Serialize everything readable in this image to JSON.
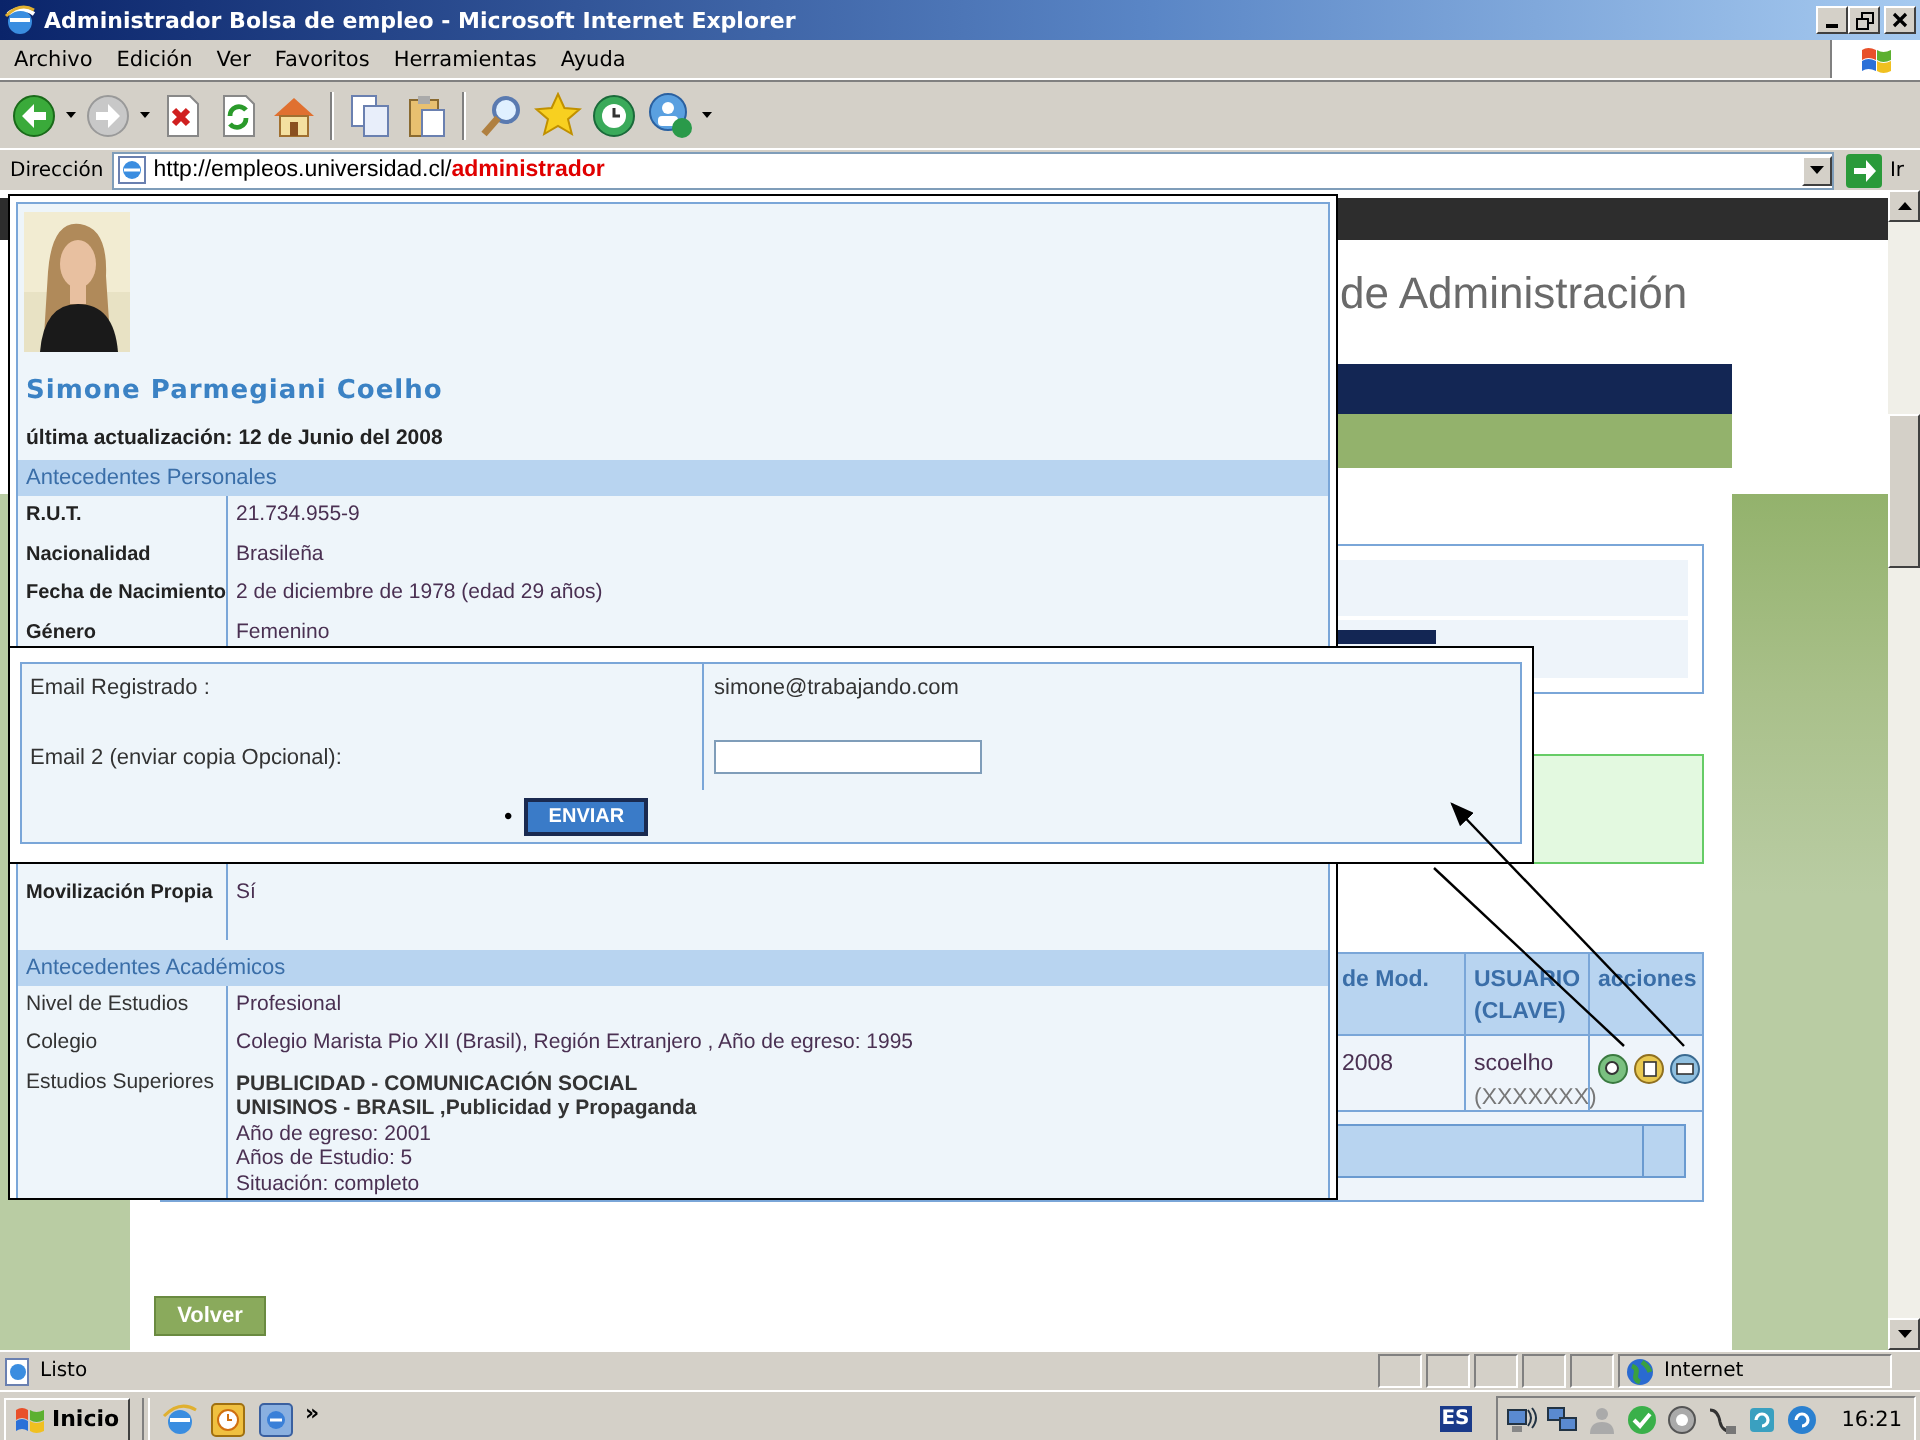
{
  "window": {
    "title": "Administrador Bolsa de empleo - Microsoft Internet Explorer"
  },
  "menu": [
    "Archivo",
    "Edición",
    "Ver",
    "Favoritos",
    "Herramientas",
    "Ayuda"
  ],
  "address_bar": {
    "label": "Dirección",
    "url": "http://empleos.universidad.cl/**administrador**",
    "go_button": "Ir"
  },
  "page": {
    "title": "de Administración",
    "table": {
      "columns": [
        "de Mod.",
        "USUARIO (CLAVE)",
        "acciones"
      ],
      "rows": [
        {
          "date": "2008",
          "user": "scoelho",
          "password": "(XXXXXXX)"
        }
      ]
    },
    "back_button": "Volver"
  },
  "profile": {
    "name": "Simone Parmegiani Coelho",
    "updated": "última actualización: 12 de Junio del 2008",
    "sections": [
      {
        "title": "Antecedentes Personales",
        "kind": "strong",
        "rows": [
          {
            "label": "R.U.T.",
            "value": "21.734.955-9"
          },
          {
            "label": "Nacionalidad",
            "value": "Brasileña"
          },
          {
            "label": "Fecha de Nacimiento",
            "value": "2 de diciembre de 1978 (edad 29 años)"
          },
          {
            "label": "Género",
            "value": "Femenino"
          },
          {
            "label": "Movilización Propia",
            "value": "Sí"
          }
        ]
      },
      {
        "title": "Antecedentes Académicos",
        "kind": "plain",
        "rows": [
          {
            "label": "Nivel de Estudios",
            "value": "Profesional"
          },
          {
            "label": "Colegio",
            "value": "Colegio Marista Pio XII (Brasil), Región Extranjero , Año de egreso: 1995"
          },
          {
            "label": "Estudios Superiores",
            "lines": [
              {
                "text": "PUBLICIDAD - COMUNICACIÓN SOCIAL",
                "bold": true
              },
              {
                "text": "UNISINOS - BRASIL ,Publicidad y Propaganda",
                "bold": true
              },
              {
                "text": "Año de egreso: 2001",
                "bold": false
              },
              {
                "text": "Años de Estudio: 5",
                "bold": false
              },
              {
                "text": "Situación: completo",
                "bold": false
              }
            ]
          }
        ]
      }
    ]
  },
  "email_form": {
    "registered_label": "Email Registrado :",
    "registered_email": "simone@trabajando.com",
    "copy_label": "Email 2 (enviar copia Opcional):",
    "bullet": "•",
    "send_button": "ENVIAR"
  },
  "status_bar": {
    "text": "Listo",
    "zone": "Internet"
  },
  "taskbar": {
    "start_button": "Inicio",
    "overflow": "»",
    "language": "ES",
    "clock": "16:21"
  }
}
